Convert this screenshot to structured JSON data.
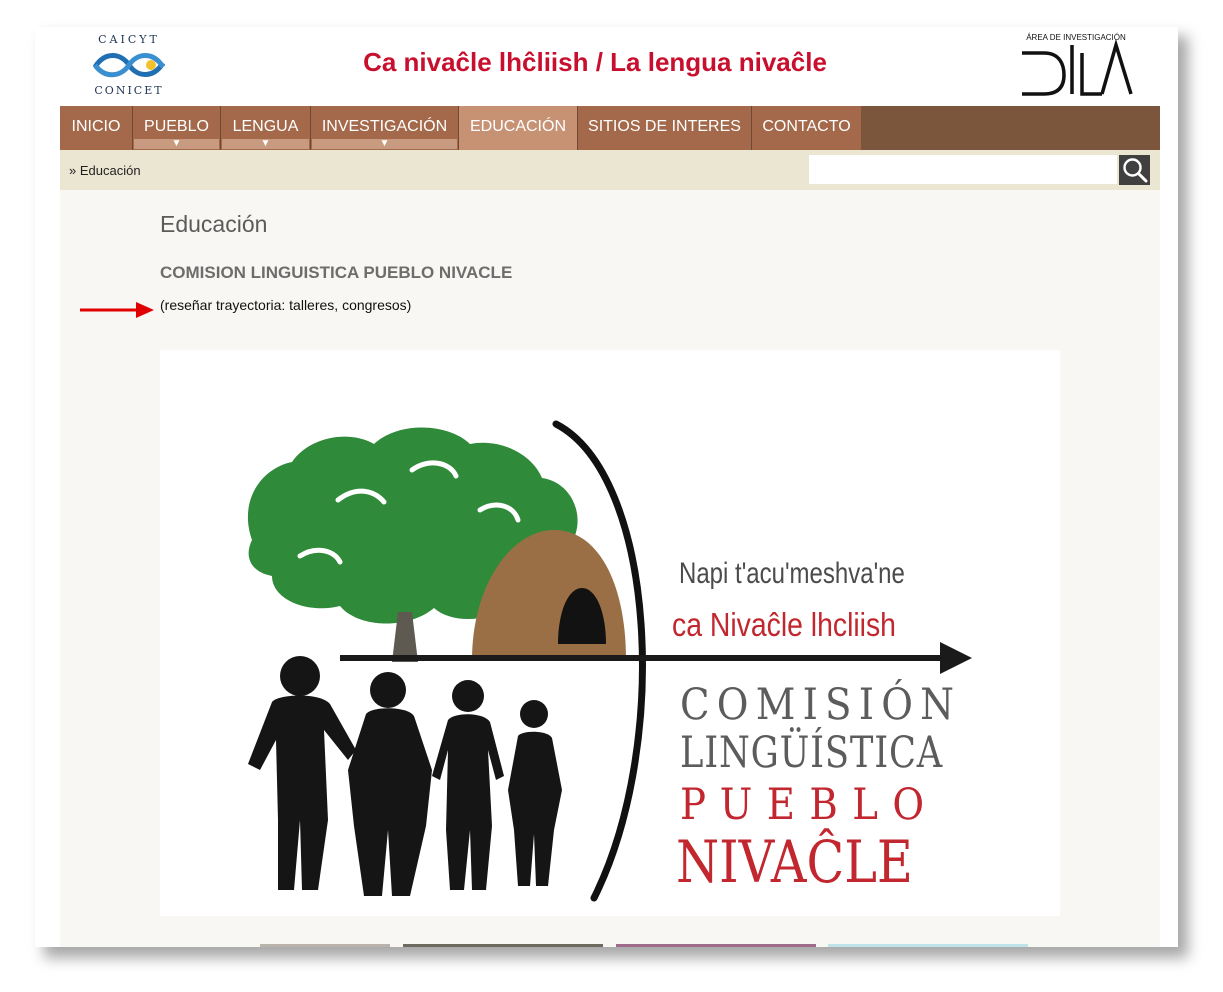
{
  "header": {
    "site_title": "Ca nivaĉle lhĉliish / La lengua nivaĉle",
    "left_logo": {
      "name": "caicyt-conicet-logo",
      "line1": "CAICYT",
      "line2": "CONICET"
    },
    "right_logo": {
      "name": "dila-logo",
      "caption": "ÁREA DE INVESTIGACIÓN",
      "wordmark": "DILA"
    }
  },
  "nav": {
    "items": [
      {
        "label": "INICIO",
        "dropdown": false,
        "active": false
      },
      {
        "label": "PUEBLO",
        "dropdown": true,
        "active": false
      },
      {
        "label": "LENGUA",
        "dropdown": true,
        "active": false
      },
      {
        "label": "INVESTIGACIÓN",
        "dropdown": true,
        "active": false
      },
      {
        "label": "EDUCACIÓN",
        "dropdown": false,
        "active": true
      },
      {
        "label": "SITIOS DE INTERES",
        "dropdown": false,
        "active": false
      },
      {
        "label": "CONTACTO",
        "dropdown": false,
        "active": false
      }
    ],
    "dropdown_glyph": "▼"
  },
  "breadcrumb": {
    "text": "» Educación"
  },
  "search": {
    "value": "",
    "placeholder": "",
    "icon": "search-icon"
  },
  "main": {
    "page_title": "Educación",
    "section_heading": "COMISION LINGUISTICA PUEBLO NIVACLE",
    "note": "(reseñar trayectoria: talleres, congresos)"
  },
  "logo_image": {
    "line1": "Napi t'acu'meshva'ne",
    "line2": "ca Nivaĉle lhcliish",
    "line3": "COMISIÓN",
    "line4": "LINGÜÍSTICA",
    "line5": "PUEBLO",
    "line6": "NIVAĈLE"
  },
  "colors": {
    "title_red": "#c8102e",
    "nav_bg": "#7b563c",
    "nav_item": "#a3694a",
    "nav_active": "#c79274",
    "breadcrumb_bg": "#ebe6d2",
    "content_bg": "#f8f7f3",
    "logo_red": "#c2262e",
    "tree_green": "#2f8a3a",
    "hut_brown": "#9b6f46",
    "annotation_arrow": "#e00000"
  }
}
